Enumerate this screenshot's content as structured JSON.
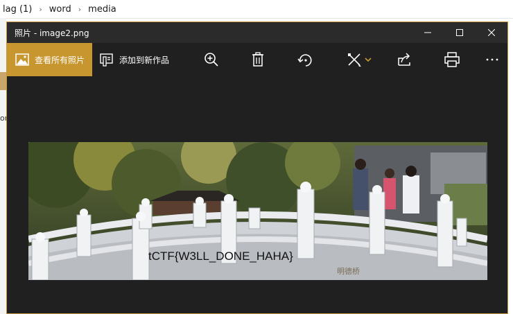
{
  "explorer": {
    "breadcrumb": [
      "lag (1)",
      "word",
      "media"
    ],
    "side_text": "on"
  },
  "window": {
    "title": "照片 - image2.png",
    "controls": [
      "minimize",
      "maximize",
      "close"
    ]
  },
  "toolbar": {
    "view_all_label": "查看所有照片",
    "add_label": "添加到新作品",
    "icons": [
      "zoom-in-icon",
      "delete-icon",
      "rotate-icon",
      "edit-icon",
      "share-icon",
      "print-icon",
      "more-icon"
    ]
  },
  "photo": {
    "flag_text": "tCTF{W3LL_DONE_HAHA}",
    "engraving": "明德桥"
  },
  "colors": {
    "accent": "#c8962f",
    "window_bg": "#202020",
    "titlebar_bg": "#2b2b2b"
  }
}
